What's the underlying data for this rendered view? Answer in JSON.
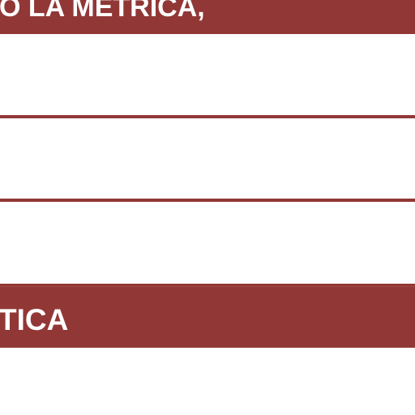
{
  "top_banner": {
    "text": "O LA METRICA,"
  },
  "bottom_banner": {
    "text": "TICA"
  },
  "colors": {
    "banner_background": "#913837",
    "banner_text": "#ffffff",
    "divider": "#913837",
    "page_background": "#ffffff"
  }
}
